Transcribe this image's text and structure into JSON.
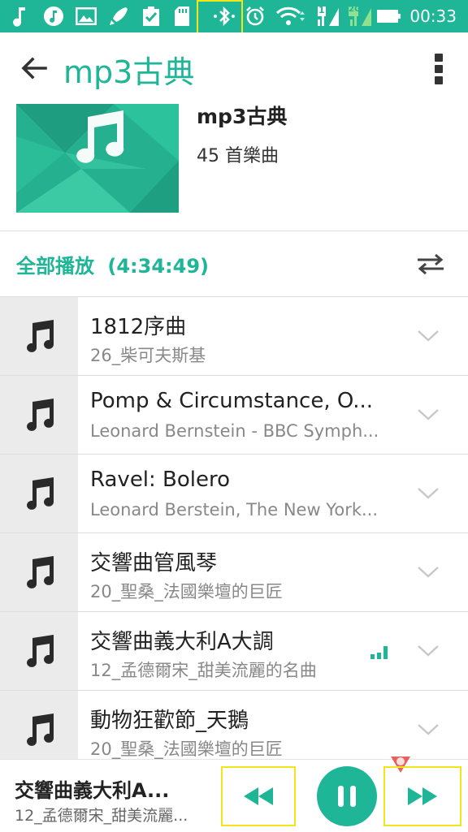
{
  "status_bar": {
    "time": "00:33",
    "badge_sim1": "1",
    "badge_sim2": "2G",
    "icons": [
      "music-note-icon",
      "music-app-icon",
      "image-icon",
      "rocket-icon",
      "clipboard-check-icon",
      "sd-card-icon",
      "bluetooth-icon",
      "alarm-icon",
      "wifi-icon",
      "signal-icon",
      "signal-icon",
      "battery-icon"
    ]
  },
  "app_bar": {
    "title": "mp3古典"
  },
  "album": {
    "title": "mp3古典",
    "count": "45 首樂曲"
  },
  "play_all": {
    "label": "全部播放",
    "duration": "(4:34:49)"
  },
  "songs": [
    {
      "title": "1812序曲",
      "subtitle": "26_柴可夫斯基",
      "playing": false
    },
    {
      "title": "Pomp & Circumstance, O...",
      "subtitle": "Leonard Bernstein - BBC Symph...",
      "playing": false
    },
    {
      "title": "Ravel: Bolero",
      "subtitle": "Leonard Berstein, The New York...",
      "playing": false
    },
    {
      "title": "交響曲管風琴",
      "subtitle": "20_聖桑_法國樂壇的巨匠",
      "playing": false
    },
    {
      "title": "交響曲義大利A大調",
      "subtitle": "12_孟德爾宋_甜美流麗的名曲",
      "playing": true
    },
    {
      "title": "動物狂歡節_天鵝",
      "subtitle": "20_聖桑_法國樂壇的巨匠",
      "playing": false
    }
  ],
  "now_playing": {
    "title": "交響曲義大利A...",
    "artist": "12_孟德爾宋_甜美流麗..."
  },
  "colors": {
    "accent": "#1fb597",
    "highlight": "#f2e51a"
  }
}
